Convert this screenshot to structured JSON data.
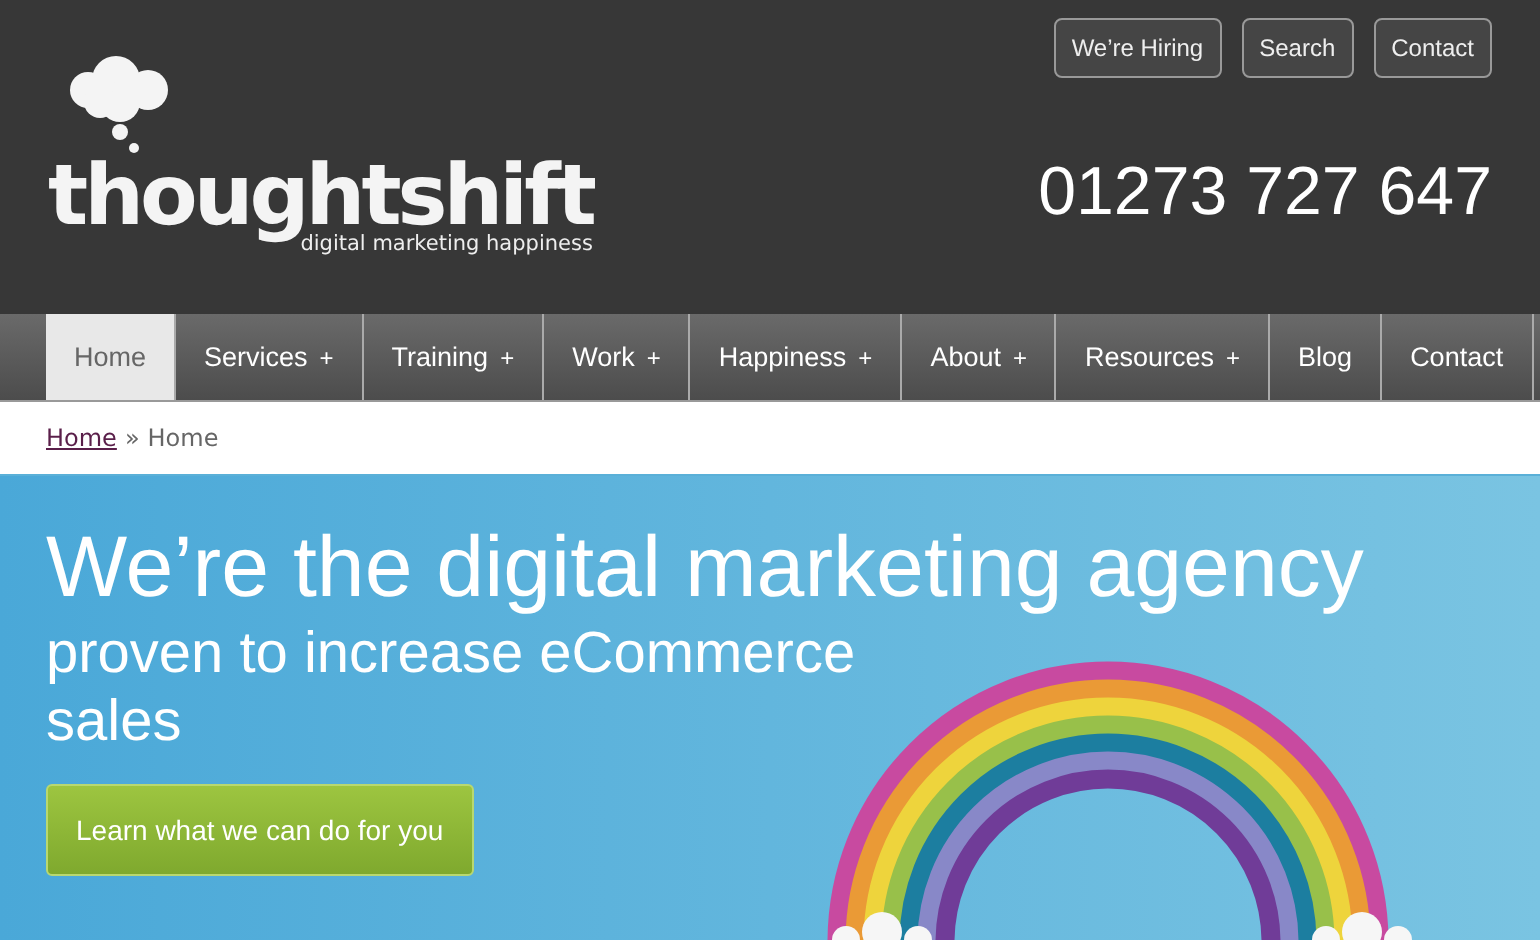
{
  "top_links": [
    "We’re Hiring",
    "Search",
    "Contact"
  ],
  "logo": {
    "name": "thoughtshift",
    "tagline": "digital marketing happiness"
  },
  "phone": "01273 727 647",
  "nav": [
    {
      "label": "Home",
      "selected": true,
      "submenu": false
    },
    {
      "label": "Services",
      "selected": false,
      "submenu": true
    },
    {
      "label": "Training",
      "selected": false,
      "submenu": true
    },
    {
      "label": "Work",
      "selected": false,
      "submenu": true
    },
    {
      "label": "Happiness",
      "selected": false,
      "submenu": true
    },
    {
      "label": "About",
      "selected": false,
      "submenu": true
    },
    {
      "label": "Resources",
      "selected": false,
      "submenu": true
    },
    {
      "label": "Blog",
      "selected": false,
      "submenu": false
    },
    {
      "label": "Contact",
      "selected": false,
      "submenu": false
    }
  ],
  "submenu_mark": "+",
  "breadcrumb": {
    "link": "Home",
    "separator": "»",
    "current": "Home"
  },
  "hero": {
    "headline": "We’re the digital marketing agency",
    "subheadline": "proven to increase eCommerce sales",
    "cta": "Learn what we can do for you"
  }
}
